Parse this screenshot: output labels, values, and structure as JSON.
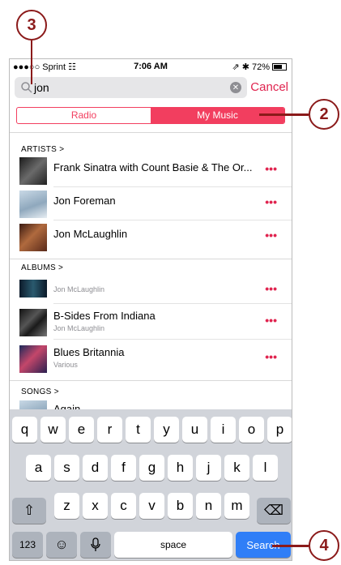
{
  "callouts": {
    "c3": "3",
    "c2": "2",
    "c4": "4"
  },
  "status": {
    "carrier": "●●●○○ Sprint ☷",
    "time": "7:06 AM",
    "right": "⇗ ✱ 72%"
  },
  "search": {
    "query": "jon",
    "cancel": "Cancel"
  },
  "segment": {
    "radio": "Radio",
    "mymusic": "My Music"
  },
  "artists": {
    "header": "ARTISTS >",
    "items": [
      {
        "title": "Frank Sinatra with Count Basie & The Or..."
      },
      {
        "title": "Jon Foreman"
      },
      {
        "title": "Jon McLaughlin"
      }
    ]
  },
  "albums": {
    "header": "ALBUMS >",
    "items": [
      {
        "title": "",
        "subtitle": "Jon McLaughlin"
      },
      {
        "title": "B-Sides From Indiana",
        "subtitle": "Jon McLaughlin"
      },
      {
        "title": "Blues Britannia",
        "subtitle": "Various"
      }
    ]
  },
  "songs": {
    "header": "SONGS >",
    "first": "Again"
  },
  "more": "•••",
  "keyboard": {
    "row1": [
      "q",
      "w",
      "e",
      "r",
      "t",
      "y",
      "u",
      "i",
      "o",
      "p"
    ],
    "row2": [
      "a",
      "s",
      "d",
      "f",
      "g",
      "h",
      "j",
      "k",
      "l"
    ],
    "row3": [
      "z",
      "x",
      "c",
      "v",
      "b",
      "n",
      "m"
    ],
    "numbers": "123",
    "space": "space",
    "search": "Search",
    "shift": "⇧",
    "delete": "⌫",
    "emoji": "☺",
    "mic": "🎙"
  },
  "colors": {
    "accent": "#e0244f",
    "callout": "#8b1a1a",
    "searchkey": "#2f7ef7"
  }
}
